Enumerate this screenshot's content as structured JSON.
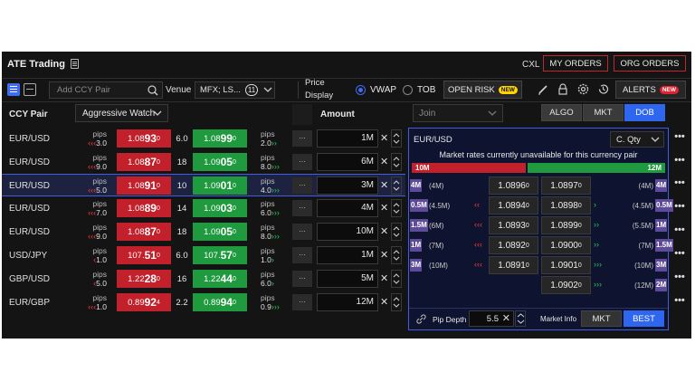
{
  "app": {
    "title": "ATE Trading",
    "cxl": "CXL",
    "my_orders": "MY ORDERS",
    "org_orders": "ORG ORDERS"
  },
  "toolbar": {
    "add_ccy_placeholder": "Add CCY Pair",
    "venue_label": "Venue",
    "venue_value": "MFX; LS...",
    "venue_count": "11",
    "price_display_label_1": "Price",
    "price_display_label_2": "Display",
    "vwap": "VWAP",
    "tob": "TOB",
    "open_risk": "OPEN RISK",
    "new_badge": "NEW",
    "alerts": "ALERTS",
    "alerts_badge": "NEW"
  },
  "grid": {
    "col_ccy": "CCY Pair",
    "watch": "Aggressive Watch",
    "col_amount": "Amount",
    "join": "Join",
    "algo": "ALGO",
    "mkt": "MKT",
    "dob": "DOB"
  },
  "rows": [
    {
      "ccy": "EUR/USD",
      "pips_label": "pips",
      "left_arrows": "‹‹‹",
      "left_pips": "3.0",
      "sell_big": "1.08",
      "sell_pip": "93",
      "sell_sup": "0",
      "spread": "6.0",
      "buy_big": "1.08",
      "buy_pip": "99",
      "buy_sup": "0",
      "right_pips": "2.0",
      "right_arrows": "››",
      "dots": "...",
      "amount": "1M"
    },
    {
      "ccy": "EUR/USD",
      "pips_label": "pips",
      "left_arrows": "‹‹‹",
      "left_pips": "9.0",
      "sell_big": "1.08",
      "sell_pip": "87",
      "sell_sup": "0",
      "spread": "18",
      "buy_big": "1.09",
      "buy_pip": "05",
      "buy_sup": "0",
      "right_pips": "8.0",
      "right_arrows": "›››",
      "dots": "...",
      "amount": "6M"
    },
    {
      "ccy": "EUR/USD",
      "pips_label": "pips",
      "left_arrows": "‹‹‹",
      "left_pips": "5.0",
      "sell_big": "1.08",
      "sell_pip": "91",
      "sell_sup": "0",
      "spread": "10",
      "buy_big": "1.09",
      "buy_pip": "01",
      "buy_sup": "0",
      "right_pips": "4.0",
      "right_arrows": "›››",
      "dots": "...",
      "amount": "3M"
    },
    {
      "ccy": "EUR/USD",
      "pips_label": "pips",
      "left_arrows": "‹‹‹",
      "left_pips": "7.0",
      "sell_big": "1.08",
      "sell_pip": "89",
      "sell_sup": "0",
      "spread": "14",
      "buy_big": "1.09",
      "buy_pip": "03",
      "buy_sup": "0",
      "right_pips": "6.0",
      "right_arrows": "›››",
      "dots": "...",
      "amount": "4M"
    },
    {
      "ccy": "EUR/USD",
      "pips_label": "pips",
      "left_arrows": "‹‹‹",
      "left_pips": "9.0",
      "sell_big": "1.08",
      "sell_pip": "87",
      "sell_sup": "0",
      "spread": "18",
      "buy_big": "1.09",
      "buy_pip": "05",
      "buy_sup": "0",
      "right_pips": "8.0",
      "right_arrows": "›››",
      "dots": "...",
      "amount": "10M"
    },
    {
      "ccy": "USD/JPY",
      "pips_label": "pips",
      "left_arrows": "‹",
      "left_pips": "1.0",
      "sell_big": "107.",
      "sell_pip": "51",
      "sell_sup": "0",
      "spread": "6.0",
      "buy_big": "107.",
      "buy_pip": "57",
      "buy_sup": "0",
      "right_pips": "1.0",
      "right_arrows": "›",
      "dots": "...",
      "amount": "1M"
    },
    {
      "ccy": "GBP/USD",
      "pips_label": "pips",
      "left_arrows": "‹",
      "left_pips": "5.0",
      "sell_big": "1.22",
      "sell_pip": "28",
      "sell_sup": "0",
      "spread": "16",
      "buy_big": "1.22",
      "buy_pip": "44",
      "buy_sup": "0",
      "right_pips": "6.0",
      "right_arrows": "›",
      "dots": "...",
      "amount": "5M"
    },
    {
      "ccy": "EUR/GBP",
      "pips_label": "pips",
      "left_arrows": "‹‹‹",
      "left_pips": "1.0",
      "sell_big": "0.89",
      "sell_pip": "92",
      "sell_sup": "4",
      "spread": "2.2",
      "buy_big": "0.89",
      "buy_pip": "94",
      "buy_sup": "0",
      "right_pips": "0.9",
      "right_arrows": "›››",
      "dots": "...",
      "amount": "12M"
    }
  ],
  "dob": {
    "pair": "EUR/USD",
    "qty_select": "C. Qty",
    "message": "Market rates currently unavailable for this currency pair",
    "bid_total": "10M",
    "ask_total": "12M",
    "bid_share": 0.45,
    "bid_levels": [
      {
        "size": "4M",
        "paren": "(4M)",
        "arrows": "",
        "price": "1.0896",
        "sup": "0"
      },
      {
        "size": "0.5M",
        "paren": "(4.5M)",
        "arrows": "‹‹",
        "price": "1.0894",
        "sup": "0"
      },
      {
        "size": "1.5M",
        "paren": "(6M)",
        "arrows": "‹‹‹",
        "price": "1.0893",
        "sup": "0"
      },
      {
        "size": "1M",
        "paren": "(7M)",
        "arrows": "‹‹‹",
        "price": "1.0892",
        "sup": "0"
      },
      {
        "size": "3M",
        "paren": "(10M)",
        "arrows": "‹‹‹",
        "price": "1.0891",
        "sup": "0"
      }
    ],
    "ask_levels": [
      {
        "size": "4M",
        "paren": "(4M)",
        "arrows": "",
        "price": "1.0897",
        "sup": "0"
      },
      {
        "size": "0.5M",
        "paren": "(4.5M)",
        "arrows": "›",
        "price": "1.0898",
        "sup": "0"
      },
      {
        "size": "1M",
        "paren": "(5.5M)",
        "arrows": "››",
        "price": "1.0899",
        "sup": "0"
      },
      {
        "size": "1.5M",
        "paren": "(7M)",
        "arrows": "››",
        "price": "1.0900",
        "sup": "0"
      },
      {
        "size": "3M",
        "paren": "(10M)",
        "arrows": "›››",
        "price": "1.0901",
        "sup": "0"
      },
      {
        "size": "2M",
        "paren": "(12M)",
        "arrows": "›››",
        "price": "1.0902",
        "sup": "0"
      }
    ],
    "pip_depth_label": "Pip Depth",
    "pip_depth_value": "5.5",
    "market_info": "Market Info",
    "mkt": "MKT",
    "best": "BEST"
  },
  "more_icon": "•••"
}
